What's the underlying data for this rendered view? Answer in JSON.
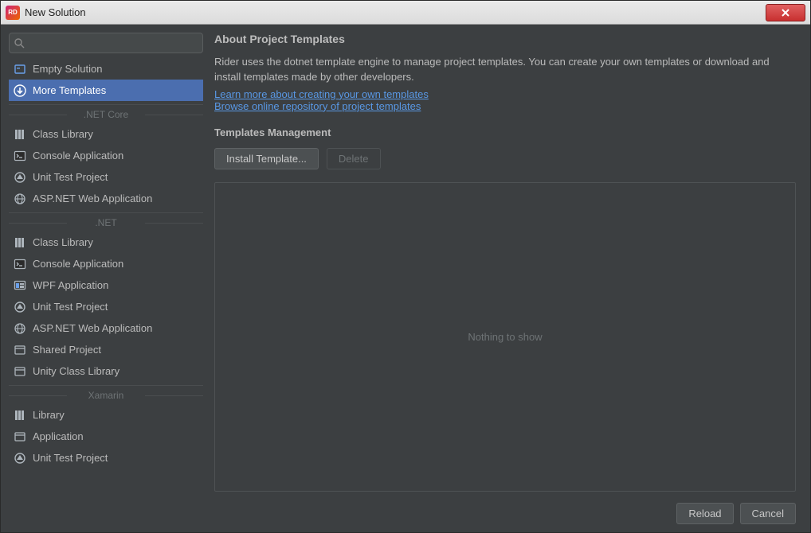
{
  "window": {
    "title": "New Solution",
    "app_icon_text": "RD"
  },
  "search": {
    "value": "",
    "placeholder": ""
  },
  "sidebar": {
    "top_items": [
      {
        "icon": "empty-solution-icon",
        "label": "Empty Solution"
      },
      {
        "icon": "download-icon",
        "label": "More Templates",
        "selected": true
      }
    ],
    "sections": [
      {
        "title": ".NET Core",
        "items": [
          {
            "icon": "library-icon",
            "label": "Class Library"
          },
          {
            "icon": "console-icon",
            "label": "Console Application"
          },
          {
            "icon": "tests-icon",
            "label": "Unit Test Project"
          },
          {
            "icon": "globe-icon",
            "label": "ASP.NET Web Application"
          }
        ]
      },
      {
        "title": ".NET",
        "items": [
          {
            "icon": "library-icon",
            "label": "Class Library"
          },
          {
            "icon": "console-icon",
            "label": "Console Application"
          },
          {
            "icon": "wpf-icon",
            "label": "WPF Application"
          },
          {
            "icon": "tests-icon",
            "label": "Unit Test Project"
          },
          {
            "icon": "globe-icon",
            "label": "ASP.NET Web Application"
          },
          {
            "icon": "window-icon",
            "label": "Shared Project"
          },
          {
            "icon": "window-icon",
            "label": "Unity Class Library"
          }
        ]
      },
      {
        "title": "Xamarin",
        "items": [
          {
            "icon": "library-icon",
            "label": "Library"
          },
          {
            "icon": "window-icon",
            "label": "Application"
          },
          {
            "icon": "tests-icon",
            "label": "Unit Test Project"
          }
        ]
      }
    ]
  },
  "main": {
    "about_heading": "About Project Templates",
    "about_text": "Rider uses the dotnet template engine to manage project templates. You can create your own templates or download and install templates made by other developers.",
    "link_learn": "Learn more about creating your own templates",
    "link_browse": "Browse online repository of project templates",
    "mgmt_heading": "Templates Management",
    "install_btn": "Install Template...",
    "delete_btn": "Delete",
    "empty_text": "Nothing to show",
    "reload_btn": "Reload",
    "cancel_btn": "Cancel"
  }
}
